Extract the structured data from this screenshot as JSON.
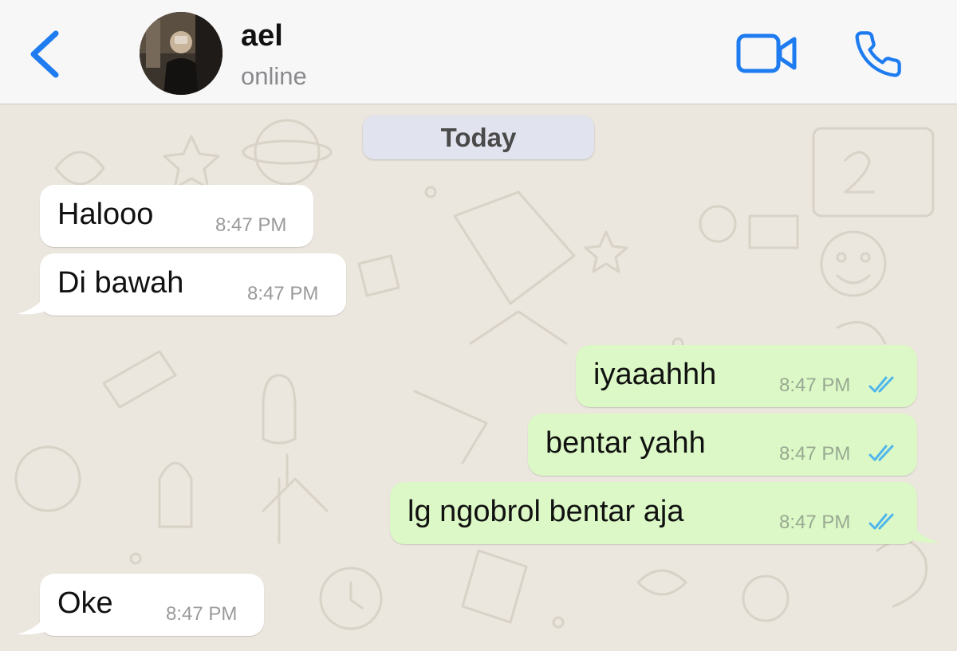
{
  "header": {
    "contact_name": "ael",
    "contact_status": "online"
  },
  "icons": {
    "back": "chevron-left-icon",
    "video": "video-camera-icon",
    "call": "phone-icon",
    "read_receipt": "double-check-icon"
  },
  "colors": {
    "accent": "#1f7cf0",
    "incoming_bubble": "#ffffff",
    "outgoing_bubble": "#dcf8c6",
    "read_ticks": "#4fb6ec",
    "chat_background": "#ebe6de"
  },
  "chat": {
    "date_separator": "Today",
    "messages": [
      {
        "direction": "in",
        "text": "Halooo",
        "time": "8:47 PM"
      },
      {
        "direction": "in",
        "text": "Di bawah",
        "time": "8:47 PM"
      },
      {
        "direction": "out",
        "text": "iyaaahhh",
        "time": "8:47 PM",
        "status": "read"
      },
      {
        "direction": "out",
        "text": "bentar yahh",
        "time": "8:47 PM",
        "status": "read"
      },
      {
        "direction": "out",
        "text": "lg ngobrol bentar aja",
        "time": "8:47 PM",
        "status": "read"
      },
      {
        "direction": "in",
        "text": "Oke",
        "time": "8:47 PM"
      }
    ]
  }
}
